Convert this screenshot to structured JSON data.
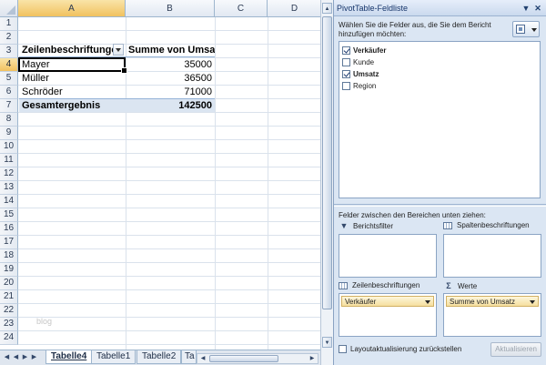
{
  "spreadsheet": {
    "columns": [
      "A",
      "B",
      "C",
      "D"
    ],
    "rows": [
      "1",
      "2",
      "3",
      "4",
      "5",
      "6",
      "7",
      "8",
      "9",
      "10",
      "11",
      "12",
      "13",
      "14",
      "15",
      "16",
      "17",
      "18",
      "19",
      "20",
      "21",
      "22",
      "23",
      "24"
    ],
    "selected_cell": "A4",
    "pivot": {
      "row_label_header": "Zeilenbeschriftungen",
      "value_header": "Summe von Umsatz",
      "rows": [
        {
          "label": "Mayer",
          "value": "35000"
        },
        {
          "label": "Müller",
          "value": "36500"
        },
        {
          "label": "Schröder",
          "value": "71000"
        }
      ],
      "total_label": "Gesamtergebnis",
      "total_value": "142500"
    },
    "watermark": "blog",
    "sheet_tabs": [
      "Tabelle4",
      "Tabelle1",
      "Tabelle2",
      "Ta"
    ],
    "active_tab": "Tabelle4"
  },
  "pivot_pane": {
    "title": "PivotTable-Feldliste",
    "instructions": "Wählen Sie die Felder aus, die Sie dem Bericht hinzufügen möchten:",
    "fields": [
      {
        "label": "Verkäufer",
        "checked": true
      },
      {
        "label": "Kunde",
        "checked": false
      },
      {
        "label": "Umsatz",
        "checked": true
      },
      {
        "label": "Region",
        "checked": false
      }
    ],
    "drag_instructions": "Felder zwischen den Bereichen unten ziehen:",
    "areas": {
      "report_filter": "Berichtsfilter",
      "column_labels": "Spaltenbeschriftungen",
      "row_labels": "Zeilenbeschriftungen",
      "values": "Werte",
      "row_items": [
        "Verkäufer"
      ],
      "value_items": [
        "Summe von Umsatz"
      ]
    },
    "defer_update_label": "Layoutaktualisierung zurückstellen",
    "update_button": "Aktualisieren",
    "icons": {
      "dropdown": "chevron-down-icon",
      "close": "close-icon",
      "filter": "filter-icon",
      "sigma": "sigma-icon"
    }
  }
}
